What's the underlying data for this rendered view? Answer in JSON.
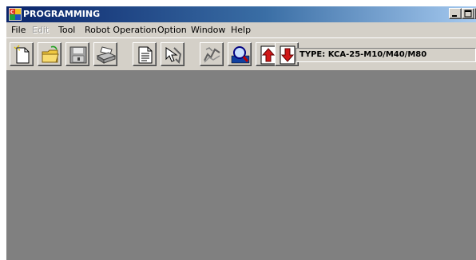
{
  "window": {
    "title": "PROGRAMMING",
    "icon": "app-logo-icon"
  },
  "menu": {
    "items": [
      "File",
      "Edit",
      "Tool",
      "Robot Operation",
      "Option",
      "Window",
      "Help"
    ],
    "disabled": [
      "Edit"
    ]
  },
  "toolbar": {
    "buttons": [
      {
        "name": "new-file",
        "icon": "new-document-icon"
      },
      {
        "name": "open-file",
        "icon": "open-folder-icon"
      },
      {
        "name": "save-file",
        "icon": "save-disk-icon"
      },
      {
        "name": "print",
        "icon": "printer-icon"
      },
      {
        "name": "edit-document",
        "icon": "document-edit-icon"
      },
      {
        "name": "robot-arm",
        "icon": "robot-arm-icon"
      },
      {
        "name": "search",
        "icon": "search-chart-icon"
      },
      {
        "name": "magnify",
        "icon": "magnifier-icon"
      },
      {
        "name": "upload",
        "icon": "up-arrow-icon"
      },
      {
        "name": "download",
        "icon": "down-arrow-icon"
      }
    ],
    "type_label": "TYPE: KCA-25-M10/M40/M80"
  },
  "colors": {
    "titlebar_start": "#0a246a",
    "titlebar_end": "#a6caf0",
    "workspace": "#808080",
    "chrome": "#d4d0c8"
  }
}
